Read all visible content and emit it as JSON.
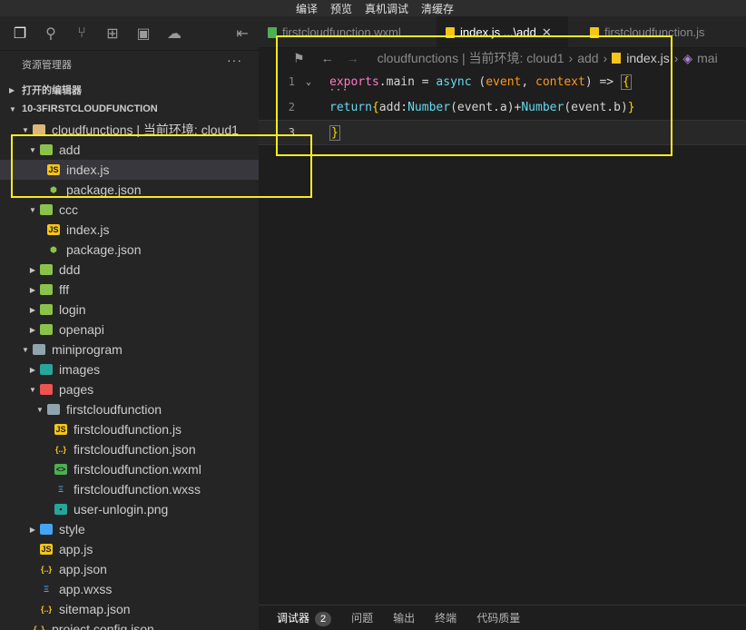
{
  "menu": [
    "编译",
    "预览",
    "真机调试",
    "清缓存"
  ],
  "activity_icons": [
    "explorer-icon",
    "search-icon",
    "source-control-icon",
    "extensions-icon",
    "gallery-icon",
    "docker-icon",
    "panel-toggle-icon"
  ],
  "sidebar": {
    "title": "资源管理器",
    "more": "···",
    "sections": [
      {
        "label": "打开的编辑器"
      },
      {
        "label": "10-3FIRSTCLOUDFUNCTION"
      }
    ],
    "tree": [
      {
        "label": "cloudfunctions | 当前环境: cloud1",
        "icon": "folder-yellow-icon",
        "depth": 1,
        "chev": "open"
      },
      {
        "label": "add",
        "icon": "cloud-folder-icon",
        "depth": 2,
        "chev": "open"
      },
      {
        "label": "index.js",
        "icon": "js-file-icon",
        "depth": 3,
        "chev": "none",
        "selected": true
      },
      {
        "label": "package.json",
        "icon": "package-json-icon",
        "depth": 3,
        "chev": "none"
      },
      {
        "label": "ccc",
        "icon": "cloud-folder-icon",
        "depth": 2,
        "chev": "open"
      },
      {
        "label": "index.js",
        "icon": "js-file-icon",
        "depth": 3,
        "chev": "none"
      },
      {
        "label": "package.json",
        "icon": "package-json-icon",
        "depth": 3,
        "chev": "none"
      },
      {
        "label": "ddd",
        "icon": "cloud-folder-icon",
        "depth": 2,
        "chev": "closed"
      },
      {
        "label": "fff",
        "icon": "cloud-folder-icon",
        "depth": 2,
        "chev": "closed"
      },
      {
        "label": "login",
        "icon": "cloud-folder-icon",
        "depth": 2,
        "chev": "closed"
      },
      {
        "label": "openapi",
        "icon": "cloud-folder-icon",
        "depth": 2,
        "chev": "closed"
      },
      {
        "label": "miniprogram",
        "icon": "folder-icon",
        "depth": 1,
        "chev": "open"
      },
      {
        "label": "images",
        "icon": "images-folder-icon",
        "depth": 2,
        "chev": "closed"
      },
      {
        "label": "pages",
        "icon": "pages-folder-icon",
        "depth": 2,
        "chev": "open"
      },
      {
        "label": "firstcloudfunction",
        "icon": "folder-icon",
        "depth": 3,
        "chev": "open"
      },
      {
        "label": "firstcloudfunction.js",
        "icon": "js-file-icon",
        "depth": 4,
        "chev": "none"
      },
      {
        "label": "firstcloudfunction.json",
        "icon": "json-file-icon",
        "depth": 4,
        "chev": "none"
      },
      {
        "label": "firstcloudfunction.wxml",
        "icon": "wxml-file-icon",
        "depth": 4,
        "chev": "none"
      },
      {
        "label": "firstcloudfunction.wxss",
        "icon": "wxss-file-icon",
        "depth": 4,
        "chev": "none"
      },
      {
        "label": "user-unlogin.png",
        "icon": "png-file-icon",
        "depth": 4,
        "chev": "none"
      },
      {
        "label": "style",
        "icon": "style-folder-icon",
        "depth": 2,
        "chev": "closed"
      },
      {
        "label": "app.js",
        "icon": "js-file-icon",
        "depth": 2,
        "chev": "none"
      },
      {
        "label": "app.json",
        "icon": "json-file-icon",
        "depth": 2,
        "chev": "none"
      },
      {
        "label": "app.wxss",
        "icon": "wxss-file-icon",
        "depth": 2,
        "chev": "none"
      },
      {
        "label": "sitemap.json",
        "icon": "json-file-icon",
        "depth": 2,
        "chev": "none"
      },
      {
        "label": "project.config.json",
        "icon": "json-file-icon",
        "depth": 1,
        "chev": "none"
      }
    ]
  },
  "tabs": [
    {
      "label": "firstcloudfunction.wxml",
      "icon": "wxml-file-icon",
      "active": false
    },
    {
      "label": "index.js ...\\add",
      "icon": "js-file-icon",
      "active": true,
      "close": "✕"
    },
    {
      "label": "firstcloudfunction.js",
      "icon": "js-file-icon",
      "active": false
    }
  ],
  "breadcrumb": {
    "parts": [
      "cloudfunctions | 当前环境: cloud1",
      "add",
      "index.js",
      "mai"
    ]
  },
  "code": {
    "line_numbers": [
      "1",
      "2",
      "3"
    ],
    "line1": {
      "a": "exports",
      "b": ".main",
      "c": " = ",
      "d": "async",
      "e": " (",
      "f": "event",
      "g": ", ",
      "h": "context",
      "i": ") => ",
      "j": "{"
    },
    "line1_dots": "···",
    "line2": {
      "a": "return",
      "b": "{",
      "c": "add",
      "d": ":",
      "e": "Number",
      "f": "(event.a)+",
      "g": "Number",
      "h": "(event.b)",
      "i": "}"
    },
    "line3": {
      "a": "}"
    }
  },
  "panel": {
    "tabs": [
      "调试器",
      "问题",
      "输出",
      "终端",
      "代码质量"
    ],
    "badge": "2"
  },
  "highlight_color": "#f5ec1e"
}
